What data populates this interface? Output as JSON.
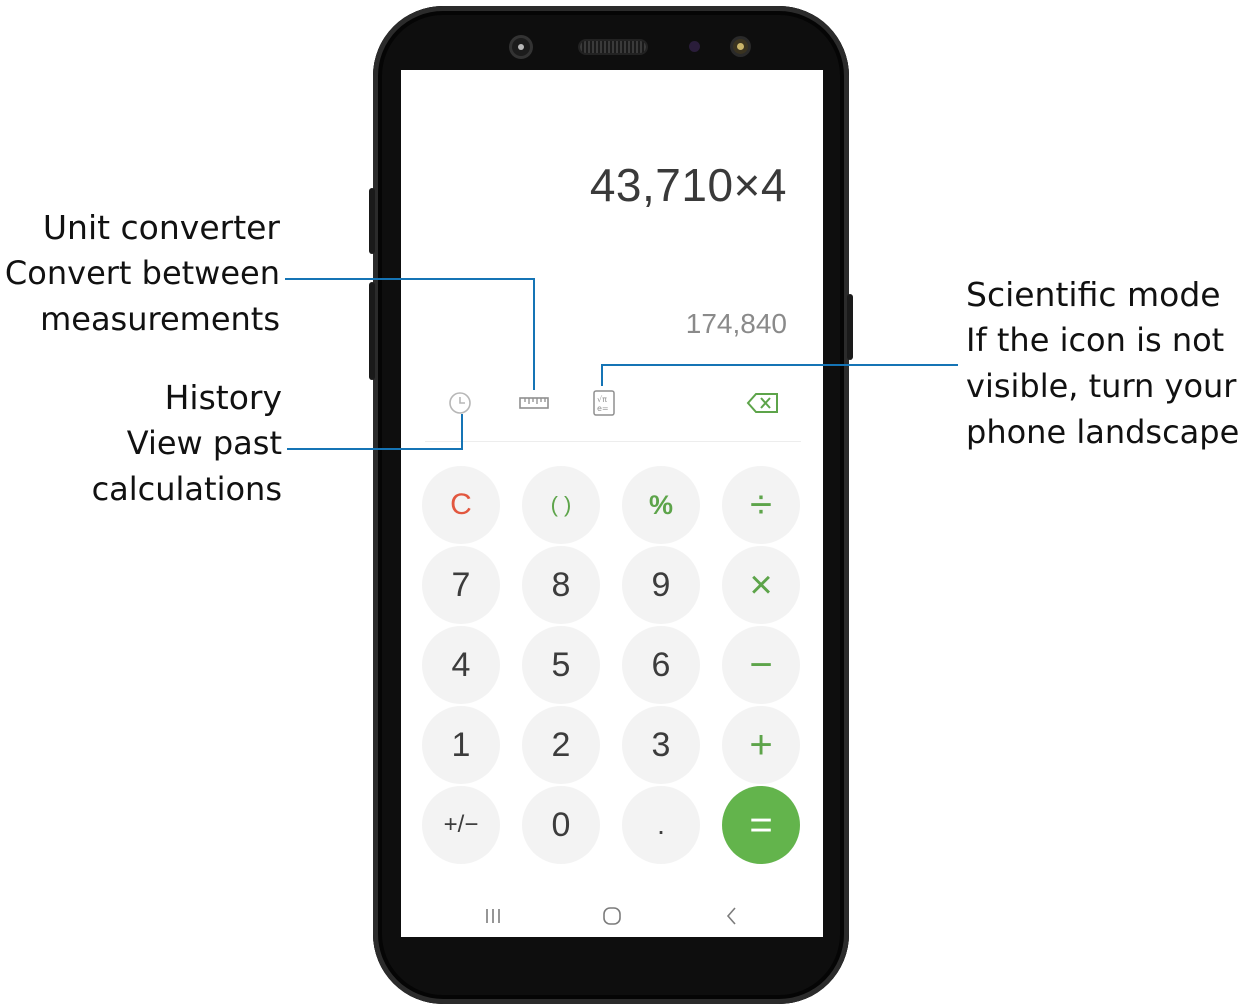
{
  "callouts": {
    "unit_converter": {
      "title": "Unit converter",
      "desc_line1": "Convert between",
      "desc_line2": "measurements"
    },
    "history": {
      "title": "History",
      "desc_line1": "View past",
      "desc_line2": "calculations"
    },
    "scientific": {
      "title": "Scientific mode",
      "desc_line1": "If the icon is not",
      "desc_line2": "visible, turn your",
      "desc_line3": "phone landscape"
    }
  },
  "calculator": {
    "expression_number": "43,710",
    "expression_operator": "×",
    "expression_operand": "4",
    "result": "174,840",
    "keys": {
      "clear": "C",
      "parens": "( )",
      "percent": "%",
      "divide": "÷",
      "seven": "7",
      "eight": "8",
      "nine": "9",
      "multiply": "×",
      "four": "4",
      "five": "5",
      "six": "6",
      "minus": "−",
      "one": "1",
      "two": "2",
      "three": "3",
      "plus": "+",
      "plus_minus": "+/−",
      "zero": "0",
      "decimal": ".",
      "equals": "="
    }
  },
  "colors": {
    "leader_line": "#1574b5",
    "accent_green": "#63b44c",
    "clear_red": "#e2573f"
  },
  "icons": [
    "history-icon",
    "unit-converter-icon",
    "scientific-mode-icon",
    "backspace-icon",
    "recents-nav-icon",
    "home-nav-icon",
    "back-nav-icon"
  ]
}
